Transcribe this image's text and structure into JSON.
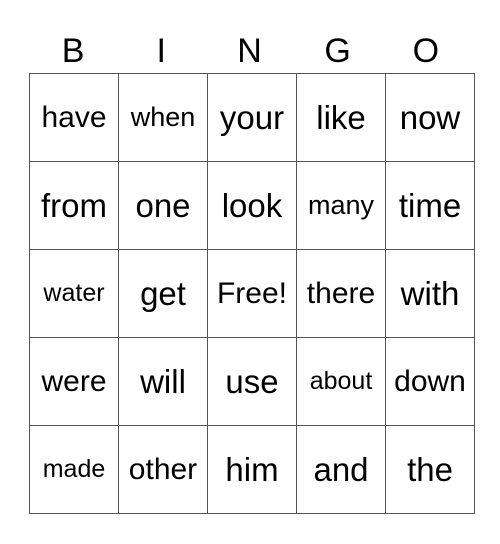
{
  "header": [
    "B",
    "I",
    "N",
    "G",
    "O"
  ],
  "rows": [
    [
      "have",
      "when",
      "your",
      "like",
      "now"
    ],
    [
      "from",
      "one",
      "look",
      "many",
      "time"
    ],
    [
      "water",
      "get",
      "Free!",
      "there",
      "with"
    ],
    [
      "were",
      "will",
      "use",
      "about",
      "down"
    ],
    [
      "made",
      "other",
      "him",
      "and",
      "the"
    ]
  ]
}
